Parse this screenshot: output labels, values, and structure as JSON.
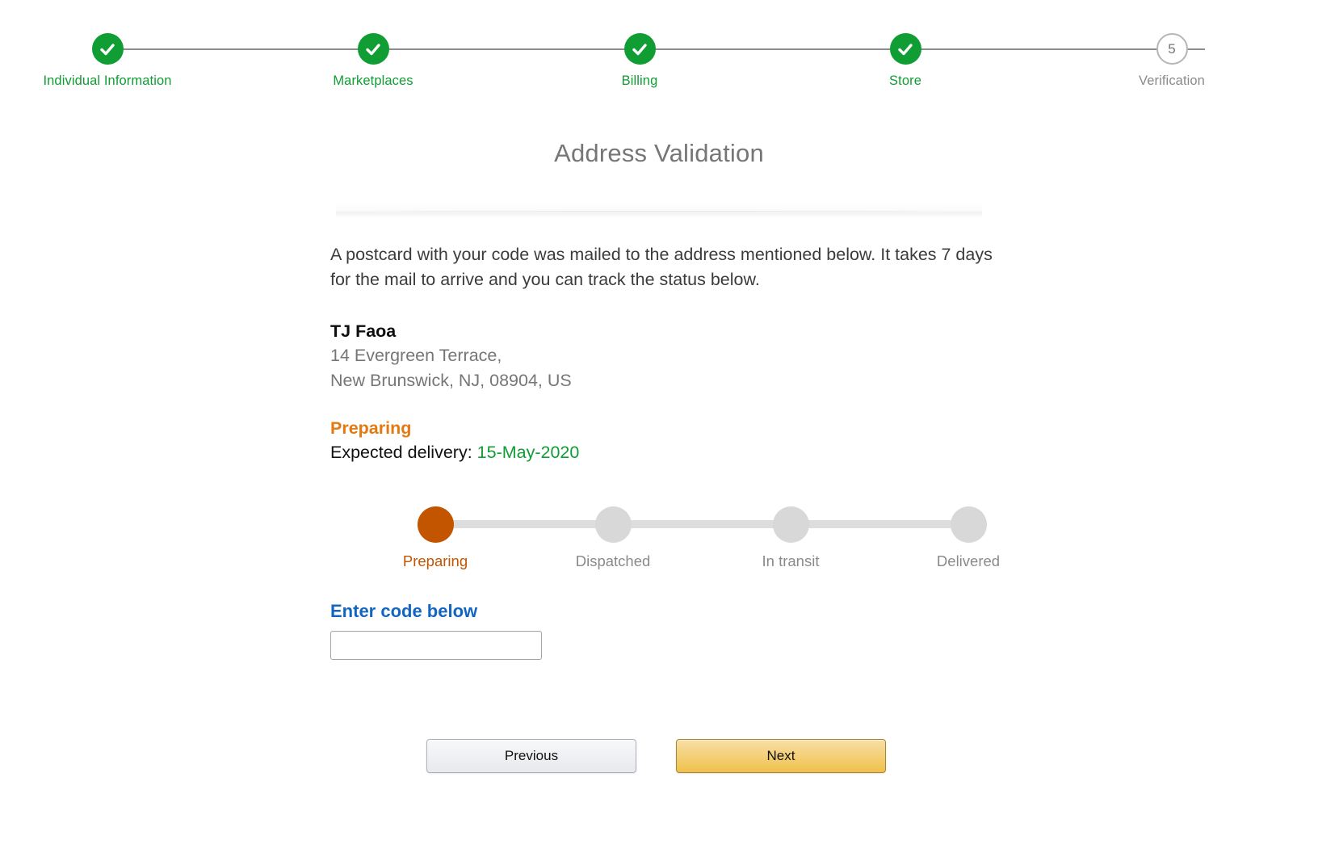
{
  "stepper": {
    "steps": [
      {
        "label": "Individual Information",
        "state": "done",
        "number": "1",
        "icon": "check-icon"
      },
      {
        "label": "Marketplaces",
        "state": "done",
        "number": "2",
        "icon": "check-icon"
      },
      {
        "label": "Billing",
        "state": "done",
        "number": "3",
        "icon": "check-icon"
      },
      {
        "label": "Store",
        "state": "done",
        "number": "4",
        "icon": "check-icon"
      },
      {
        "label": "Verification",
        "state": "pending",
        "number": "5",
        "icon": "step-number"
      }
    ],
    "done_color": "#0f9d34",
    "pending_color": "#8a8a8a"
  },
  "page": {
    "title": "Address Validation",
    "intro": "A postcard with your code was mailed to the address mentioned below. It takes 7 days for the mail to arrive and you can track the status below."
  },
  "address": {
    "name": "TJ Faoa",
    "line1": "14 Evergreen Terrace,",
    "line2": "New Brunswick, NJ, 08904, US"
  },
  "shipment": {
    "status": "Preparing",
    "status_color": "#e47911",
    "expected_label": "Expected delivery:",
    "expected_date": "15-May-2020",
    "expected_date_color": "#0f9d34",
    "steps": [
      {
        "label": "Preparing",
        "active": true
      },
      {
        "label": "Dispatched",
        "active": false
      },
      {
        "label": "In transit",
        "active": false
      },
      {
        "label": "Delivered",
        "active": false
      }
    ],
    "active_color": "#c45500",
    "inactive_color": "#d8d8d8"
  },
  "code": {
    "label": "Enter code below",
    "label_color": "#1266c1",
    "value": "",
    "placeholder": ""
  },
  "footer": {
    "previous_label": "Previous",
    "next_label": "Next",
    "next_color": "#f0c14b"
  }
}
